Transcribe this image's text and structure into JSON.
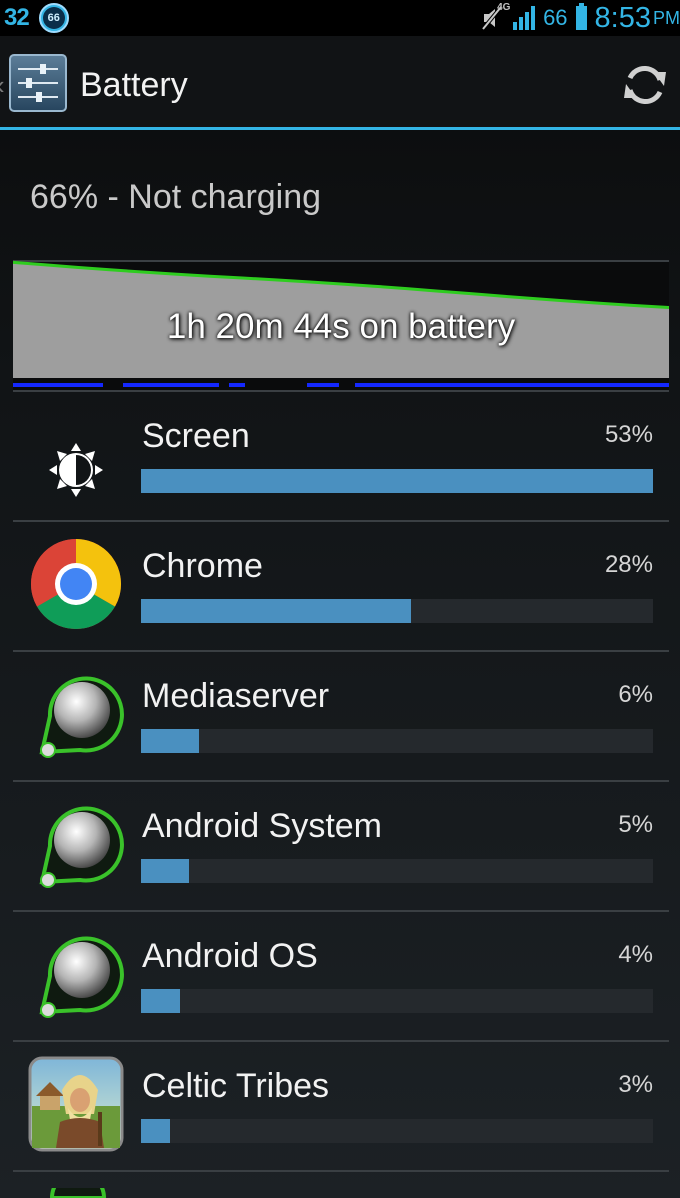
{
  "status_bar": {
    "left_number": "32",
    "notification_badge": "66",
    "network": "4G",
    "battery_percent": "66",
    "time": "8:53",
    "ampm": "PM",
    "icons": [
      "mute-icon",
      "signal-icon",
      "battery-icon"
    ]
  },
  "action_bar": {
    "title": "Battery",
    "app_icon": "settings-sliders-icon",
    "refresh_icon": "refresh-icon",
    "accent_color": "#33b5e5"
  },
  "summary": "66% - Not charging",
  "graph": {
    "label": "1h 20m 44s on battery",
    "level_start": 0.98,
    "level_end": 0.6,
    "line_color": "#2ecc1f",
    "fill_color": "#9e9e9e",
    "timeline_color": "#1428ff"
  },
  "usage": {
    "bar_color": "#4a90c0",
    "items": [
      {
        "name": "Screen",
        "percent": "53%",
        "value": 53,
        "icon": "brightness-icon"
      },
      {
        "name": "Chrome",
        "percent": "28%",
        "value": 28,
        "icon": "chrome-icon"
      },
      {
        "name": "Mediaserver",
        "percent": "6%",
        "value": 6,
        "icon": "android-system-icon"
      },
      {
        "name": "Android System",
        "percent": "5%",
        "value": 5,
        "icon": "android-system-icon"
      },
      {
        "name": "Android OS",
        "percent": "4%",
        "value": 4,
        "icon": "android-system-icon"
      },
      {
        "name": "Celtic Tribes",
        "percent": "3%",
        "value": 3,
        "icon": "celtic-tribes-game-icon"
      }
    ]
  }
}
